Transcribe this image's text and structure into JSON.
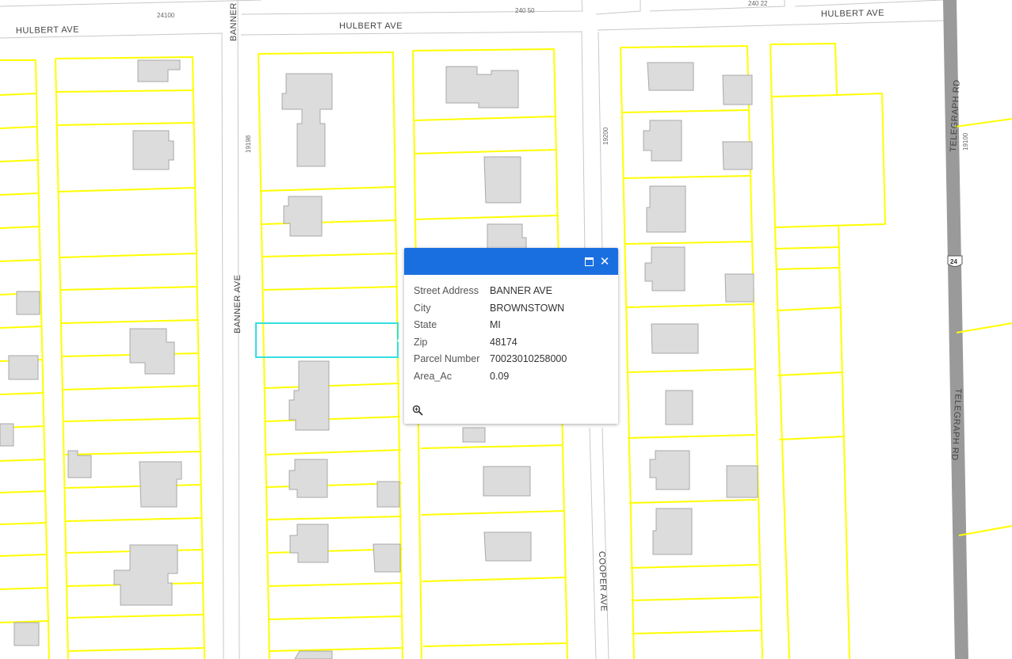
{
  "map": {
    "streets": {
      "hulbert_1": "HULBERT AVE",
      "hulbert_2": "HULBERT AVE",
      "hulbert_3": "HULBERT AVE",
      "banner_top": "BANNER",
      "banner_mid": "BANNER AVE",
      "cooper": "COOPER AVE",
      "telegraph_top": "TELEGRAPH RD",
      "telegraph_bottom": "TELEGRAPH RD"
    },
    "addresses": {
      "a24100": "24100",
      "a24050": "240 50",
      "a24022": "240 22",
      "a19198": "19198",
      "a19200": "19200",
      "a19100": "19100"
    },
    "route_shield": "24",
    "colors": {
      "parcel_outline": "#ffff00",
      "selected_parcel": "#33e0e0",
      "building_fill": "#dcdcdc",
      "building_stroke": "#a8a8a8",
      "street_line": "#cccccc",
      "highway": "#999999"
    }
  },
  "popup": {
    "maximize_icon": "maximize-icon",
    "close_label": "✕",
    "attributes": [
      {
        "key": "Street Address",
        "value": "BANNER AVE"
      },
      {
        "key": "City",
        "value": "BROWNSTOWN"
      },
      {
        "key": "State",
        "value": "MI"
      },
      {
        "key": "Zip",
        "value": "48174"
      },
      {
        "key": "Parcel Number",
        "value": "70023010258000"
      },
      {
        "key": "Area_Ac",
        "value": "0.09"
      }
    ],
    "zoom_icon": "zoom-to-icon"
  }
}
